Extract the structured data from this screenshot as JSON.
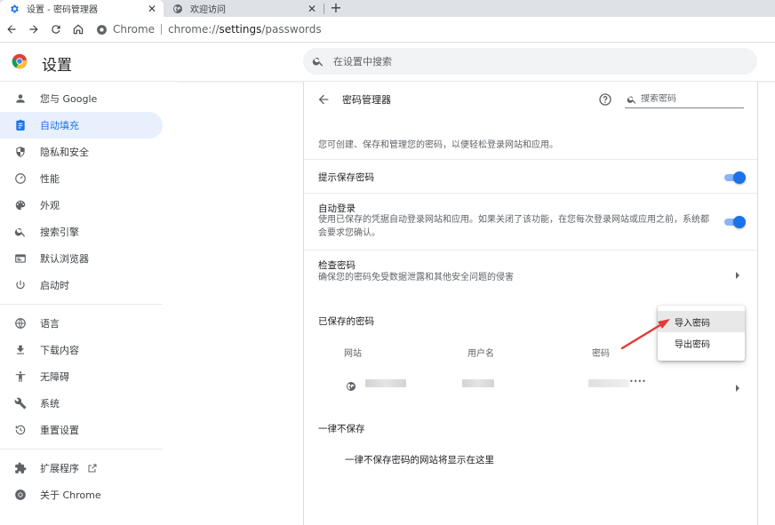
{
  "browser": {
    "tabs": [
      {
        "title": "设置 - 密码管理器",
        "active": true
      },
      {
        "title": "欢迎访问",
        "active": false
      }
    ],
    "address": {
      "site_chip": "Chrome",
      "url_scheme": "chrome://",
      "url_host": "settings",
      "url_path": "/passwords"
    }
  },
  "header": {
    "title": "设置",
    "search_placeholder": "在设置中搜索"
  },
  "sidebar": {
    "items": [
      {
        "label": "您与 Google",
        "icon": "person-icon"
      },
      {
        "label": "自动填充",
        "icon": "clipboard-icon",
        "active": true
      },
      {
        "label": "隐私和安全",
        "icon": "shield-icon"
      },
      {
        "label": "性能",
        "icon": "speedometer-icon"
      },
      {
        "label": "外观",
        "icon": "palette-icon"
      },
      {
        "label": "搜索引擎",
        "icon": "search-icon"
      },
      {
        "label": "默认浏览器",
        "icon": "browser-icon"
      },
      {
        "label": "启动时",
        "icon": "power-icon"
      },
      {
        "label": "语言",
        "icon": "globe-icon"
      },
      {
        "label": "下载内容",
        "icon": "download-icon"
      },
      {
        "label": "无障碍",
        "icon": "accessibility-icon"
      },
      {
        "label": "系统",
        "icon": "wrench-icon"
      },
      {
        "label": "重置设置",
        "icon": "reset-icon"
      },
      {
        "label": "扩展程序",
        "icon": "puzzle-icon"
      },
      {
        "label": "关于 Chrome",
        "icon": "chrome-icon"
      }
    ]
  },
  "passwords": {
    "title": "密码管理器",
    "search_placeholder": "搜索密码",
    "description": "您可创建、保存和管理您的密码，以便轻松登录网站和应用。",
    "offer_save": {
      "title": "提示保存密码",
      "enabled": true
    },
    "auto_signin": {
      "title": "自动登录",
      "subtitle": "使用已保存的凭据自动登录网站和应用。如果关闭了该功能，在您每次登录网站或应用之前，系统都会要求您确认。",
      "enabled": true
    },
    "check": {
      "title": "检查密码",
      "subtitle": "确保您的密码免受数据泄露和其他安全问题的侵害"
    },
    "saved_label": "已保存的密码",
    "columns": [
      "网站",
      "用户名",
      "密码"
    ],
    "password_mask": "••••",
    "never_saved_label": "一律不保存",
    "never_saved_empty": "一律不保存密码的网站将显示在这里"
  },
  "menu": {
    "items": [
      "导入密码",
      "导出密码"
    ],
    "hovered": 0
  },
  "colors": {
    "accent": "#1a73e8",
    "active_nav_bg": "#e8f0fe",
    "annotation_arrow": "#e53935"
  }
}
